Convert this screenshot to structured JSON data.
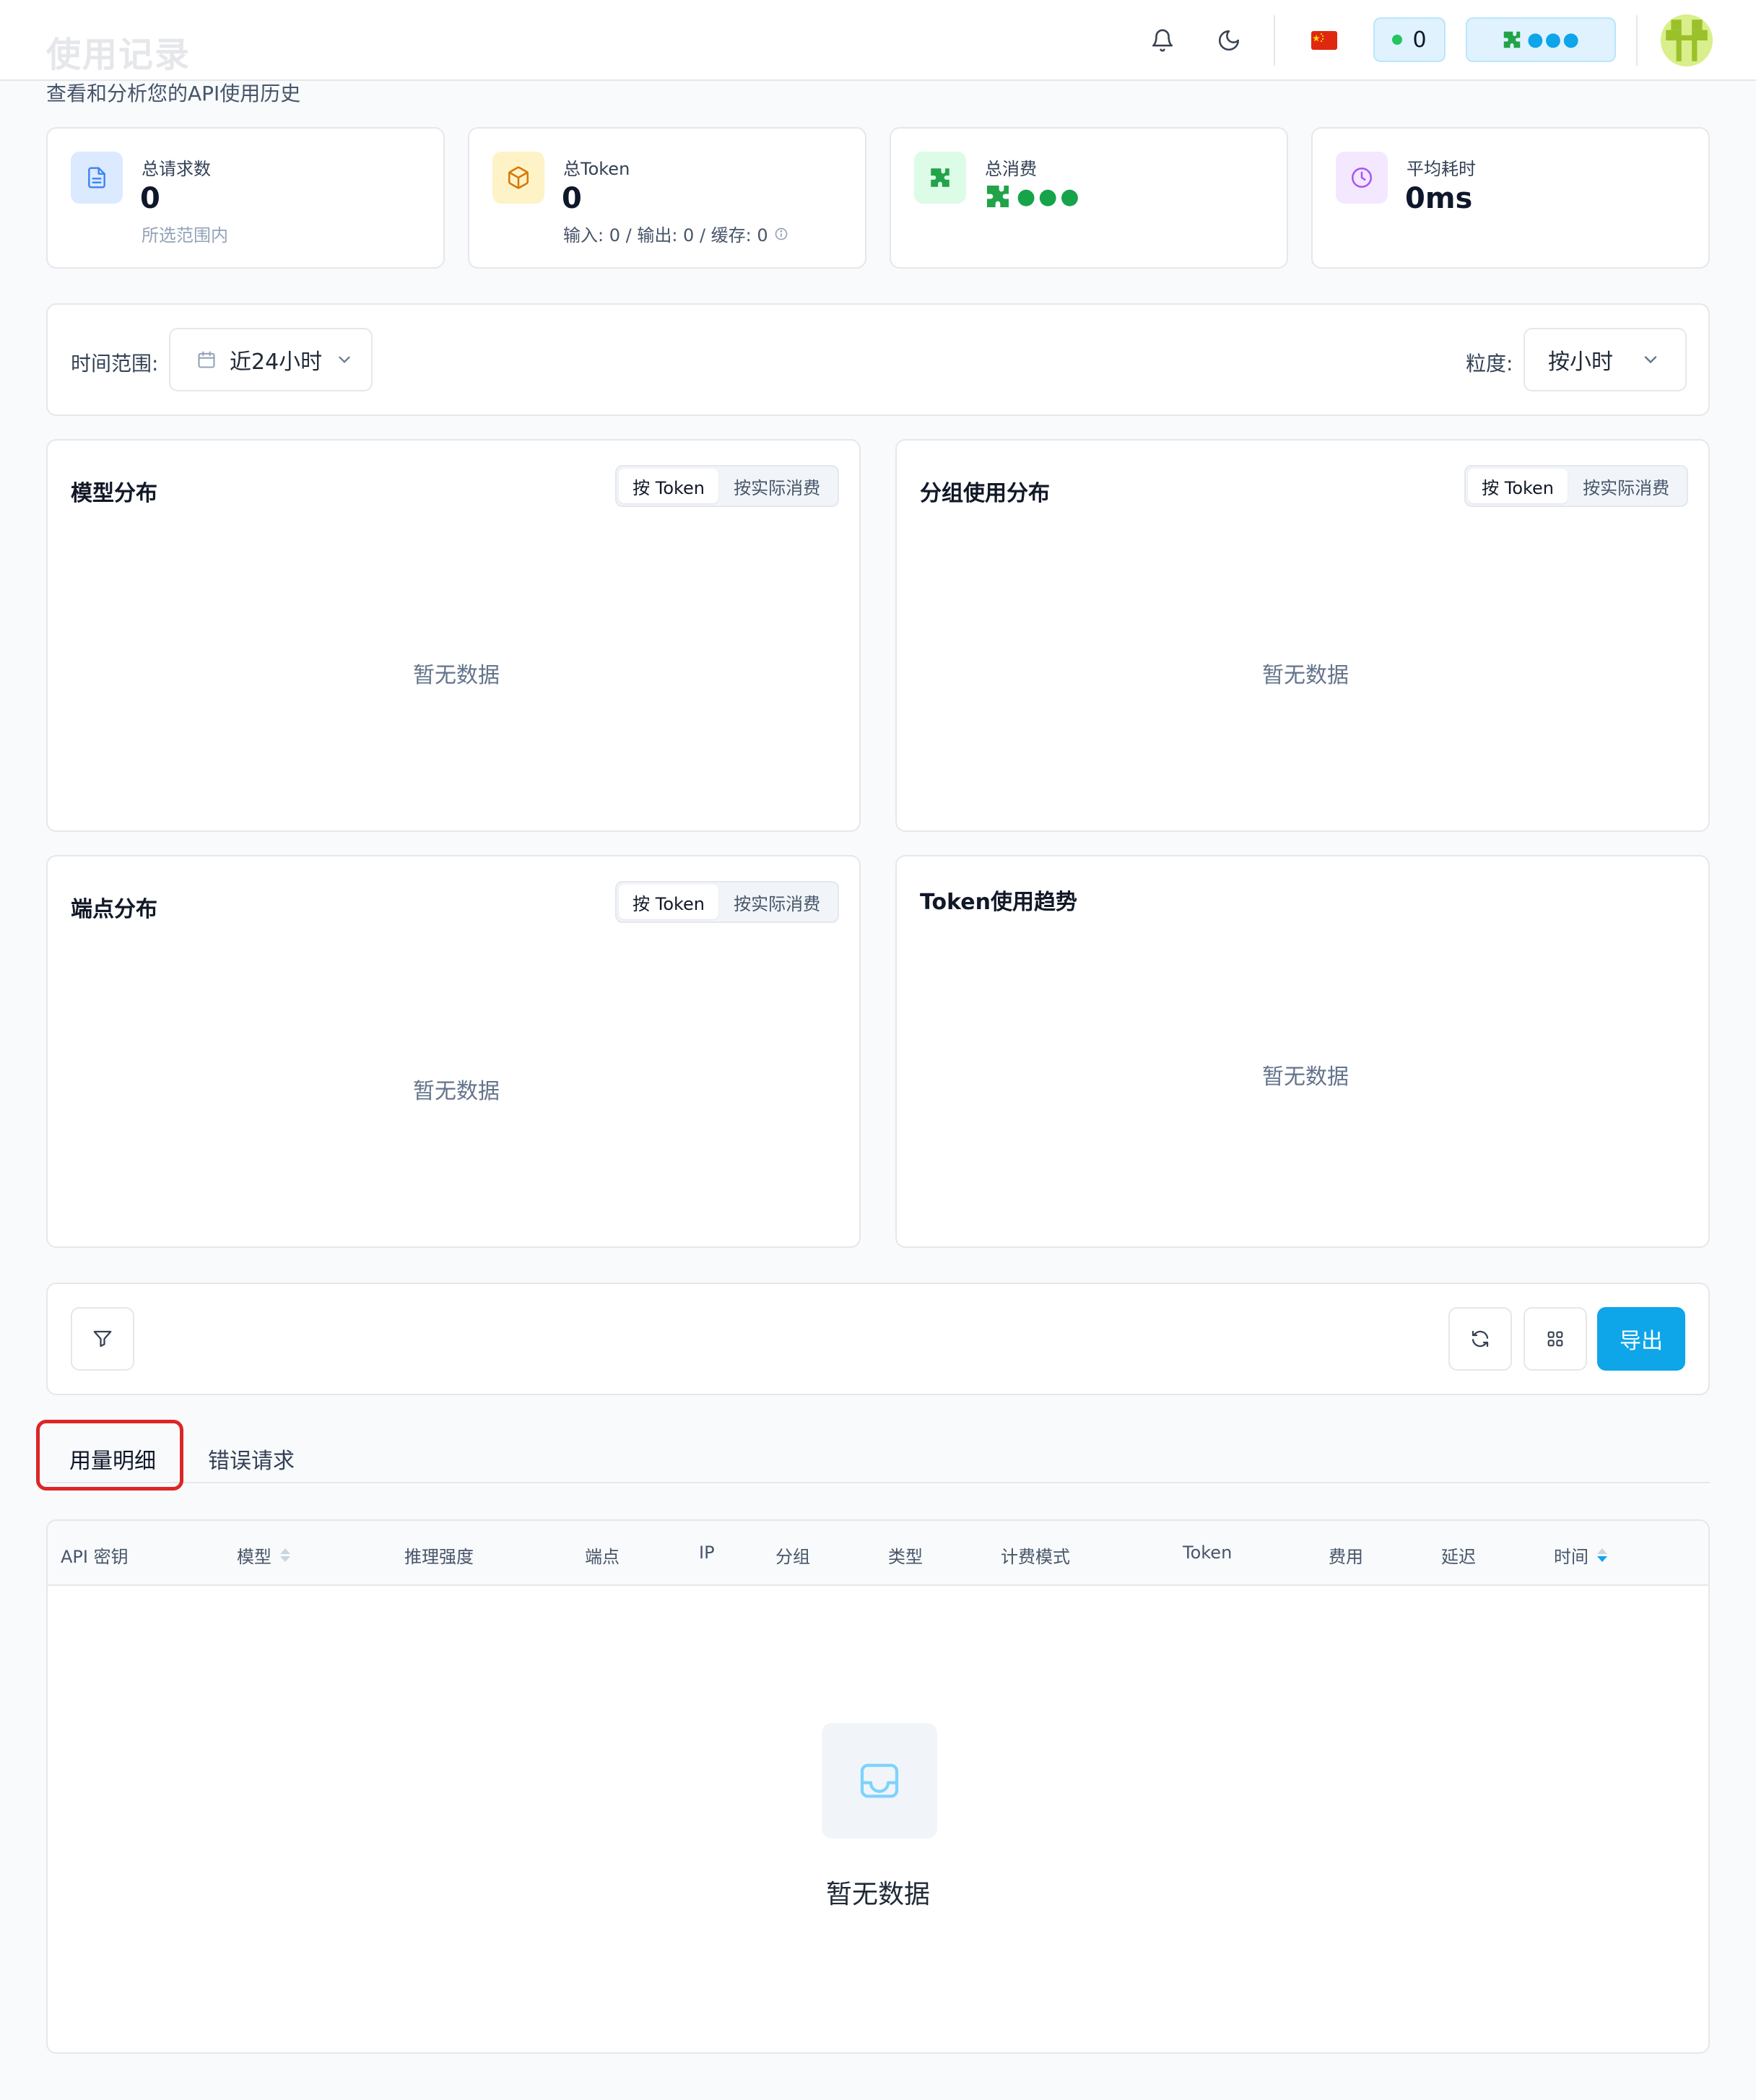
{
  "header": {
    "title": "使用记录",
    "subtitle": "查看和分析您的API使用历史",
    "status_count": "0",
    "wallet_text": "●●●",
    "flag": "🇨🇳"
  },
  "stats": [
    {
      "label": "总请求数",
      "value": "0",
      "sub": "所选范围内",
      "icon": "file-text-icon"
    },
    {
      "label": "总Token",
      "value": "0",
      "sub": "输入: 0 / 输出: 0 / 缓存: 0",
      "icon": "cube-icon"
    },
    {
      "label": "总消费",
      "value": "●●●",
      "sub": "",
      "icon": "puzzle-icon"
    },
    {
      "label": "平均耗时",
      "value": "0ms",
      "sub": "",
      "icon": "clock-icon"
    }
  ],
  "filters": {
    "time_range_label": "时间范围:",
    "time_range_value": "近24小时",
    "granularity_label": "粒度:",
    "granularity_value": "按小时"
  },
  "panels": {
    "model": {
      "title": "模型分布",
      "seg_a": "按 Token",
      "seg_b": "按实际消费",
      "empty": "暂无数据"
    },
    "group": {
      "title": "分组使用分布",
      "seg_a": "按 Token",
      "seg_b": "按实际消费",
      "empty": "暂无数据"
    },
    "endpoint": {
      "title": "端点分布",
      "seg_a": "按 Token",
      "seg_b": "按实际消费",
      "empty": "暂无数据"
    },
    "trend": {
      "title": "Token使用趋势",
      "empty": "暂无数据"
    }
  },
  "toolbar": {
    "export_label": "导出"
  },
  "tabs": [
    "用量明细",
    "错误请求"
  ],
  "table": {
    "columns": [
      "API 密钥",
      "模型",
      "推理强度",
      "端点",
      "IP",
      "分组",
      "类型",
      "计费模式",
      "Token",
      "费用",
      "延迟",
      "时间"
    ],
    "empty": "暂无数据"
  },
  "colors": {
    "accent": "#0ea5e9",
    "highlight": "#dc2626"
  }
}
